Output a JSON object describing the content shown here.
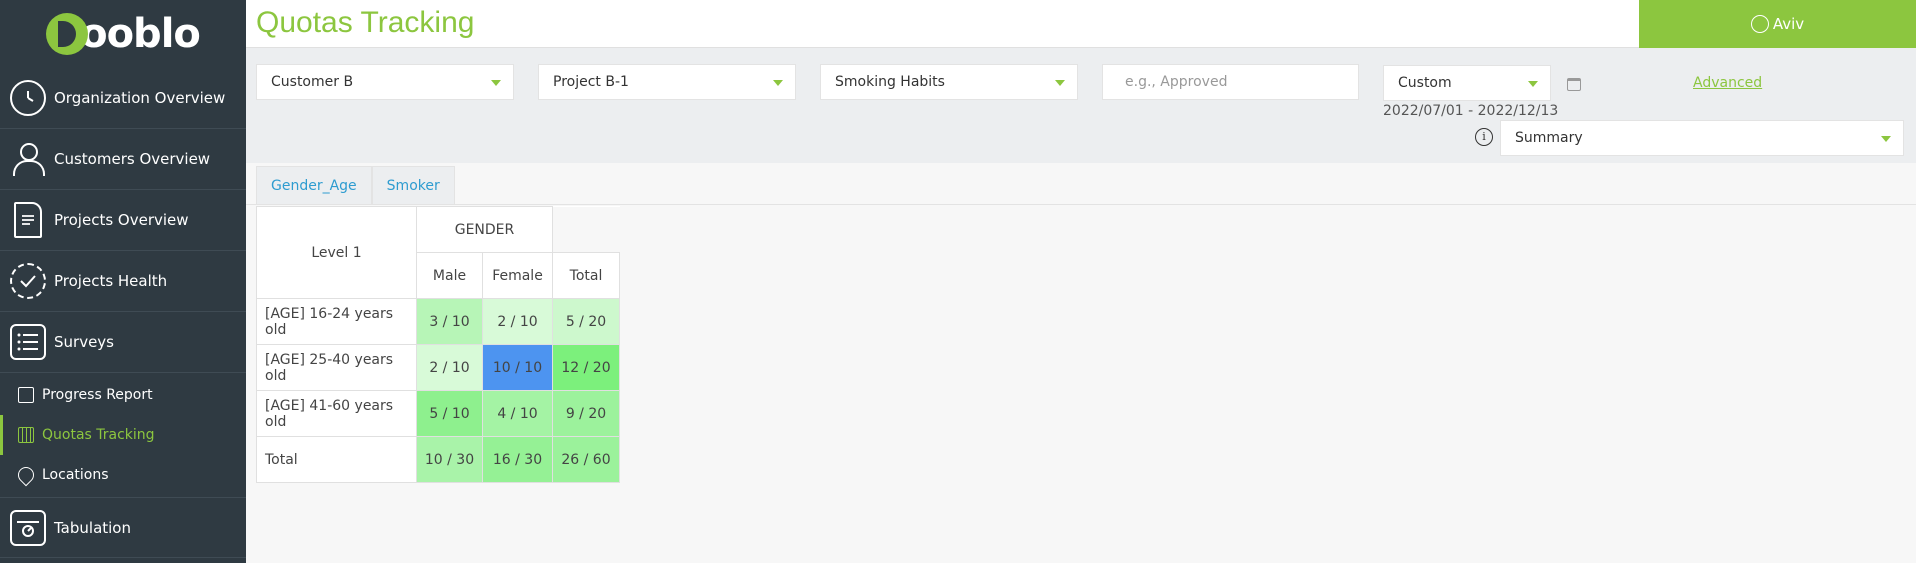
{
  "brand": {
    "logo_text": "ooblo",
    "accent": "#8cc63f",
    "sidebar_bg": "#2f3a42"
  },
  "sidebar": {
    "items": [
      {
        "label": "Organization Overview",
        "icon": "gauge-icon"
      },
      {
        "label": "Customers Overview",
        "icon": "person-icon"
      },
      {
        "label": "Projects Overview",
        "icon": "document-icon"
      },
      {
        "label": "Projects Health",
        "icon": "refresh-check-icon"
      },
      {
        "label": "Surveys",
        "icon": "list-icon"
      }
    ],
    "sub_items": [
      {
        "label": "Progress Report",
        "icon": "report-icon"
      },
      {
        "label": "Quotas Tracking",
        "icon": "grid-icon",
        "active": true
      },
      {
        "label": "Locations",
        "icon": "map-pin-icon"
      }
    ],
    "bottom_items": [
      {
        "label": "Tabulation",
        "icon": "tabulation-icon"
      }
    ]
  },
  "header": {
    "title": "Quotas Tracking",
    "user": "Aviv"
  },
  "filters": {
    "customer": "Customer B",
    "project": "Project B-1",
    "survey": "Smoking Habits",
    "status_placeholder": "e.g., Approved",
    "date_mode": "Custom",
    "date_range": "2022/07/01 - 2022/12/13",
    "advanced_label": "Advanced",
    "view": "Summary",
    "info_symbol": "i"
  },
  "tabs": [
    "Gender_Age",
    "Smoker"
  ],
  "quota_table": {
    "corner_label": "Level 1",
    "group_label": "GENDER",
    "columns": [
      "Male",
      "Female",
      "Total"
    ],
    "rows": [
      {
        "label": "[AGE] 16-24 years old",
        "cells": [
          "3 / 10",
          "2 / 10",
          "5 / 20"
        ],
        "colors": [
          "#b7f5b7",
          "#d8fad8",
          "#cdf8cd"
        ]
      },
      {
        "label": "[AGE] 25-40 years old",
        "cells": [
          "2 / 10",
          "10 / 10",
          "12 / 20"
        ],
        "colors": [
          "#d8fad8",
          "#4d94f0",
          "#7cf07c"
        ]
      },
      {
        "label": "[AGE] 41-60 years old",
        "cells": [
          "5 / 10",
          "4 / 10",
          "9 / 20"
        ],
        "colors": [
          "#8ef08e",
          "#a4f3a4",
          "#9cf29c"
        ]
      },
      {
        "label": "Total",
        "cells": [
          "10 / 30",
          "16 / 30",
          "26 / 60"
        ],
        "colors": [
          "#a9f3a9",
          "#95f195",
          "#9bf29b"
        ]
      }
    ]
  }
}
